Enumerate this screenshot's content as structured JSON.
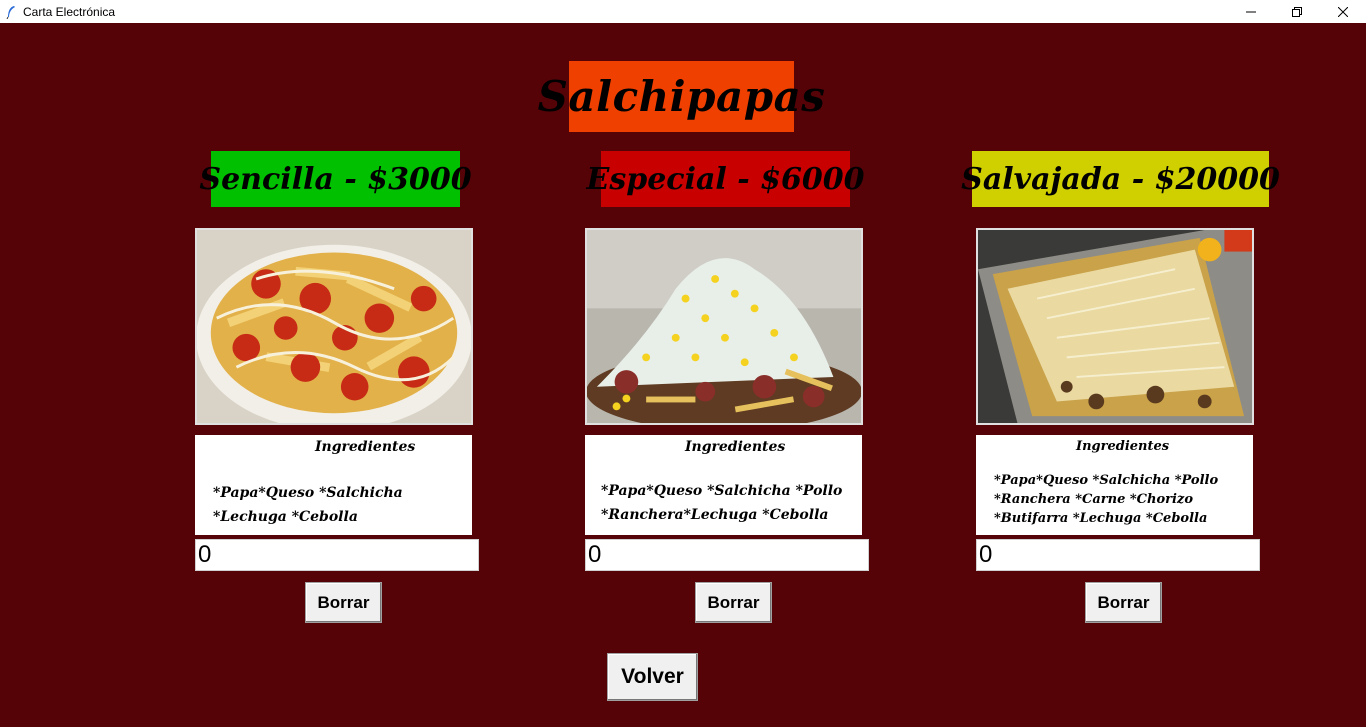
{
  "window": {
    "title": "Carta Electrónica"
  },
  "menu": {
    "title": "Salchipapas"
  },
  "products": [
    {
      "name": "Sencilla - $3000",
      "color": "#00c000",
      "image_icon": "salchipapa-sencilla-photo",
      "ingredients_title": "Ingredientes",
      "ingredients": [
        "*Papa*Queso *Salchicha",
        "*Lechuga *Cebolla"
      ],
      "quantity": "0",
      "clear_label": "Borrar"
    },
    {
      "name": "Especial - $6000",
      "color": "#c80000",
      "image_icon": "salchipapa-especial-photo",
      "ingredients_title": "Ingredientes",
      "ingredients": [
        "*Papa*Queso *Salchicha *Pollo",
        "*Ranchera*Lechuga *Cebolla"
      ],
      "quantity": "0",
      "clear_label": "Borrar"
    },
    {
      "name": "Salvajada - $20000",
      "color": "#d0d000",
      "image_icon": "salchipapa-salvajada-photo",
      "ingredients_title": "Ingredientes",
      "ingredients": [
        "*Papa*Queso *Salchicha *Pollo",
        "*Ranchera *Carne *Chorizo",
        "*Butifarra *Lechuga *Cebolla"
      ],
      "quantity": "0",
      "clear_label": "Borrar"
    }
  ],
  "back_label": "Volver",
  "colors": {
    "background": "#560308",
    "title_bg": "#f04000"
  }
}
